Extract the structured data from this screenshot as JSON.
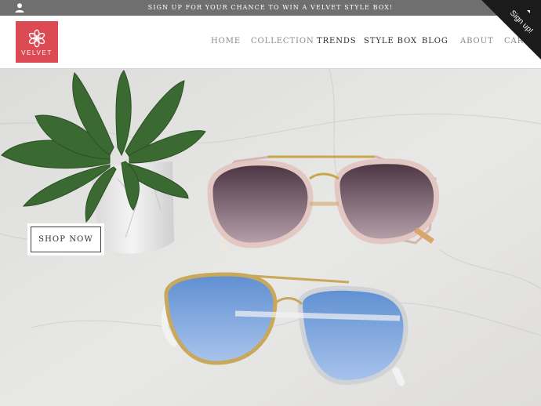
{
  "topbar": {
    "promo_text": "SIGN UP FOR YOUR CHANCE TO WIN A VELVET STYLE BOX!",
    "user_icon": "user-icon"
  },
  "header": {
    "logo_text": "VELVET",
    "logo_icon": "flower-icon",
    "brand_color": "#dc4a54",
    "nav": [
      {
        "label": "HOME"
      },
      {
        "label": "COLLECTION"
      },
      {
        "label": "TRENDS"
      },
      {
        "label": "STYLE BOX"
      },
      {
        "label": "BLOG"
      },
      {
        "label": "ABOUT"
      },
      {
        "label": "CART"
      }
    ]
  },
  "signup_corner": {
    "label": "Sign up!",
    "icon": "caret-icon",
    "color": "#1b1b1b"
  },
  "hero": {
    "button_label": "SHOP NOW",
    "image_subject": "succulent-and-sunglasses"
  }
}
